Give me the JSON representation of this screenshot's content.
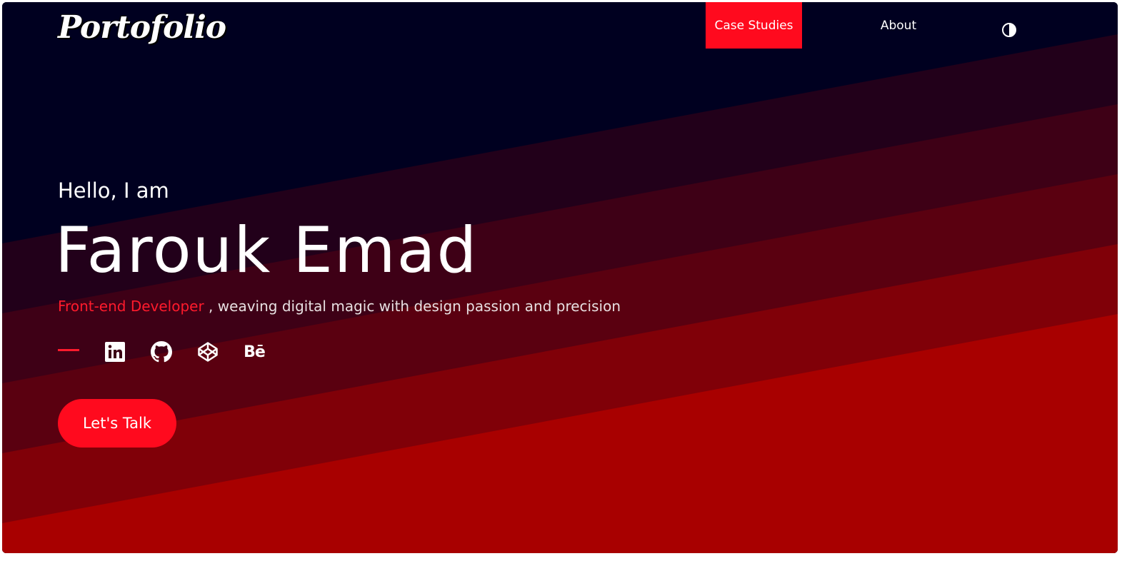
{
  "header": {
    "logo": "Portofolio",
    "nav": {
      "case_studies": "Case Studies",
      "about": "About"
    },
    "theme_toggle_icon": "half-circle-icon"
  },
  "hero": {
    "greeting": "Hello, I am",
    "name": "Farouk Emad",
    "role": "Front-end Developer",
    "tagline_rest": " , weaving digital magic with design passion and precision",
    "social": [
      {
        "icon": "linkedin-icon"
      },
      {
        "icon": "github-icon"
      },
      {
        "icon": "codepen-icon"
      },
      {
        "icon": "behance-icon",
        "text": "Bē"
      }
    ],
    "cta_label": "Let's Talk"
  },
  "colors": {
    "accent": "#ff0a1e",
    "background_dark": "#000020",
    "band_red": "#a80000"
  }
}
